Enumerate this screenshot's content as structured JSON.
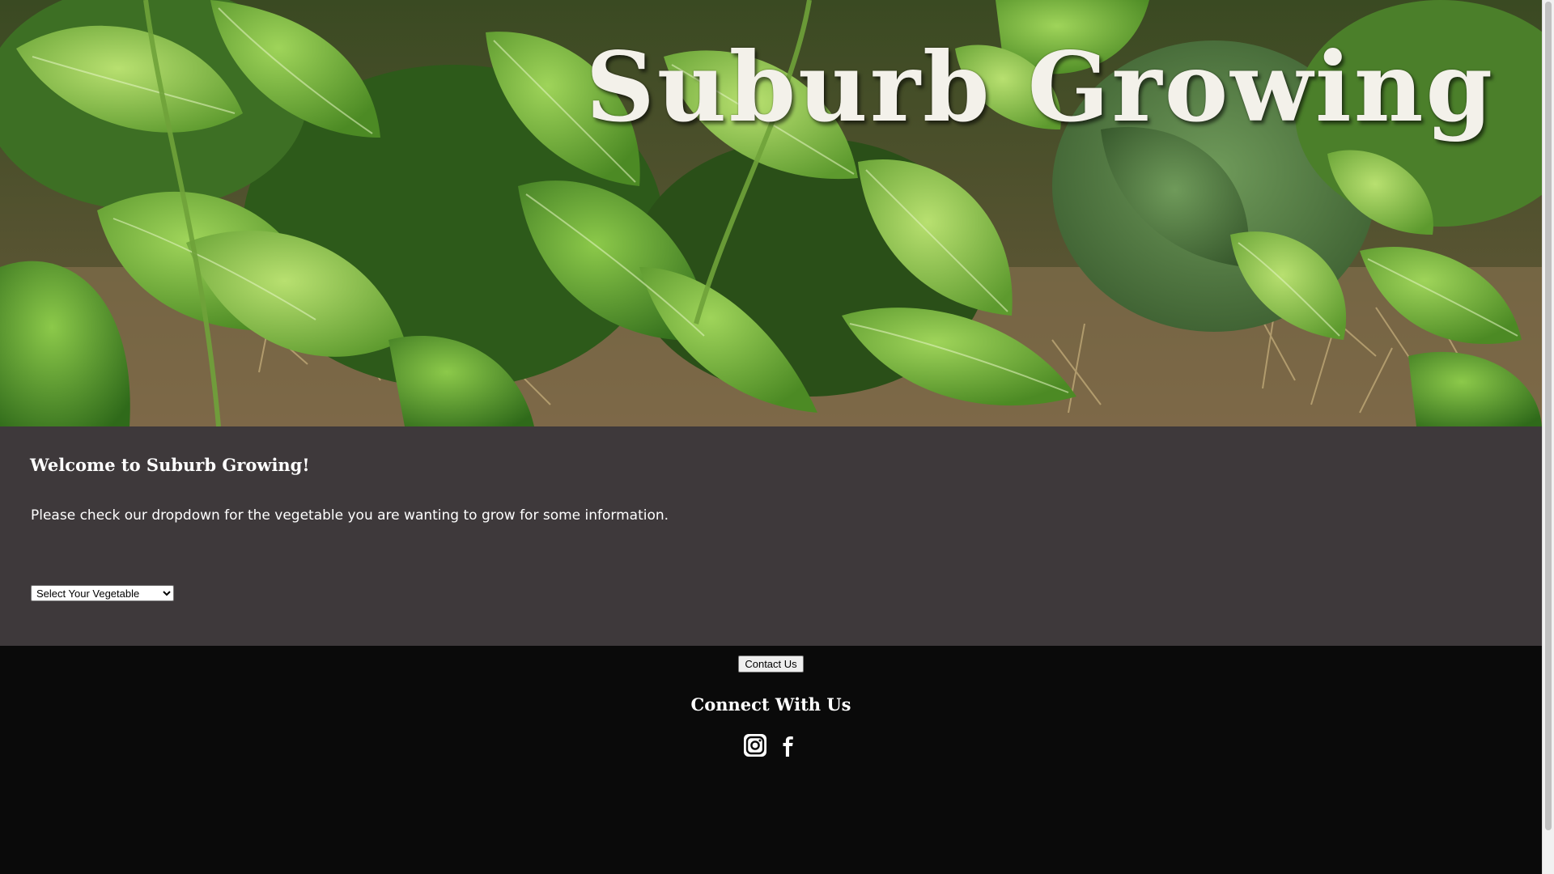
{
  "header": {
    "site_title": "Suburb Growing"
  },
  "main": {
    "welcome_heading": "Welcome to Suburb Growing!",
    "intro_text": "Please check our dropdown for the vegetable you are wanting to grow for some information.",
    "vegetable_select": {
      "selected_option": "Select Your Vegetable"
    }
  },
  "footer": {
    "contact_button_label": "Contact Us",
    "connect_heading": "Connect With Us",
    "social_icons": [
      "instagram-icon",
      "facebook-icon"
    ]
  },
  "colors": {
    "content_background": "#3e393b",
    "footer_background": "#0a0a0a",
    "text": "#ffffff"
  }
}
